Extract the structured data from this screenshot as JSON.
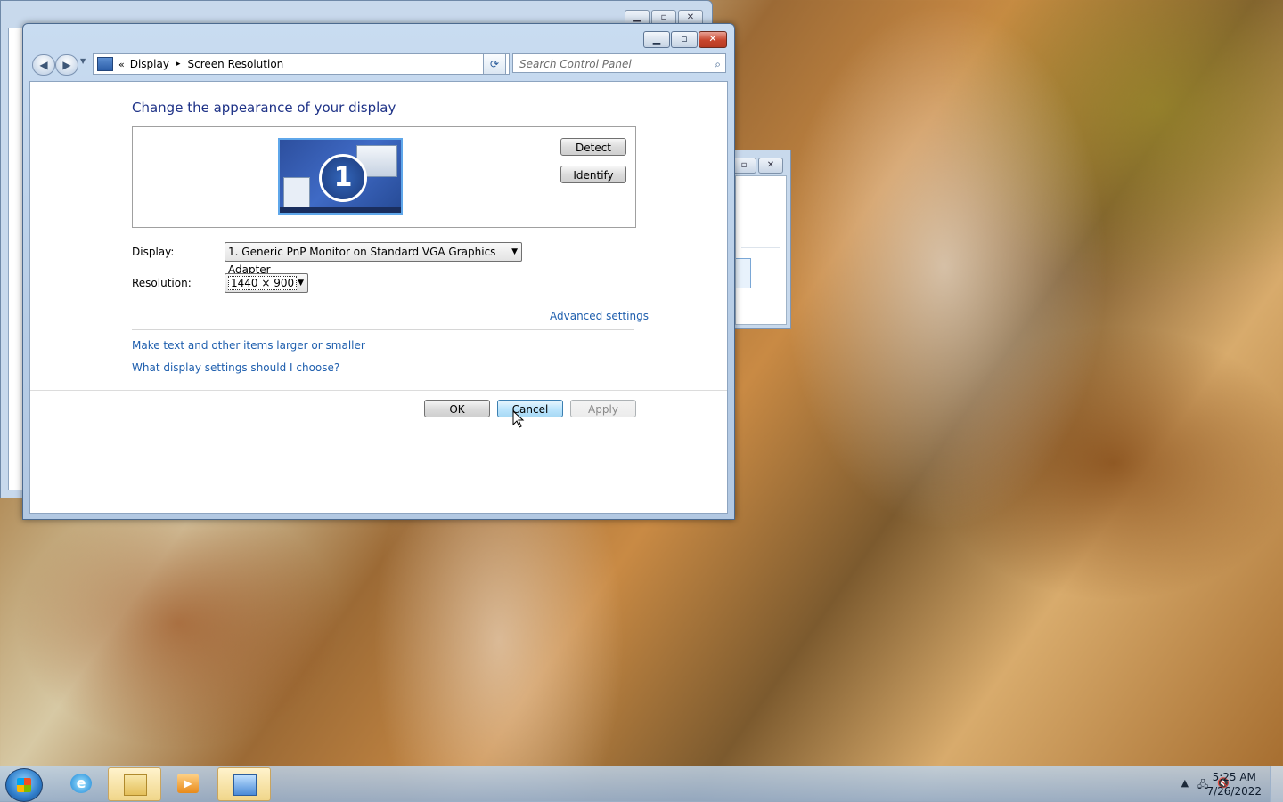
{
  "breadcrumb": {
    "chevrons": "«",
    "display": "Display",
    "arrow": "▸",
    "screen_resolution": "Screen Resolution"
  },
  "search": {
    "placeholder": "Search Control Panel"
  },
  "main": {
    "title": "Change the appearance of your display",
    "monitor_number": "1",
    "detect_label": "Detect",
    "identify_label": "Identify",
    "display_label": "Display:",
    "display_value": "1. Generic PnP Monitor on Standard VGA Graphics Adapter",
    "resolution_label": "Resolution:",
    "resolution_value": "1440 × 900",
    "advanced_link": "Advanced settings",
    "link_text_size": "Make text and other items larger or smaller",
    "link_help": "What display settings should I choose?",
    "ok_label": "OK",
    "cancel_label": "Cancel",
    "apply_label": "Apply"
  },
  "taskbar": {
    "clock_time": "5:25 AM",
    "clock_date": "7/26/2022"
  },
  "icons": [
    "back-arrow-icon",
    "forward-arrow-icon",
    "control-panel-icon",
    "refresh-icon",
    "search-icon",
    "windows-start-icon",
    "internet-explorer-icon",
    "windows-explorer-icon",
    "media-player-icon",
    "control-panel-taskbar-icon",
    "tray-up-arrow-icon",
    "network-icon",
    "volume-muted-icon"
  ]
}
